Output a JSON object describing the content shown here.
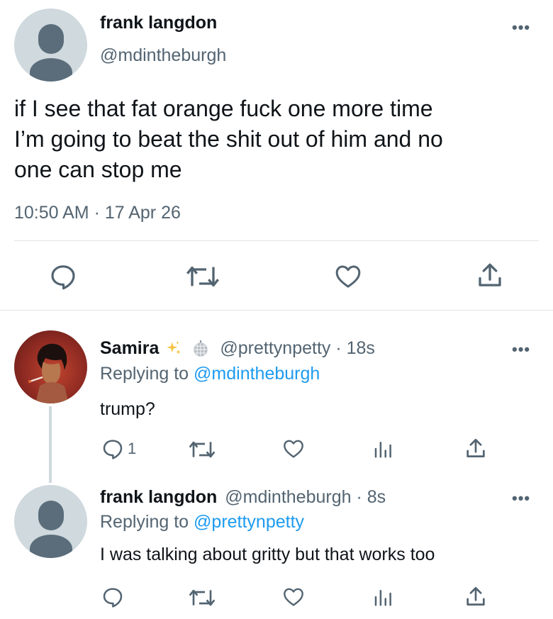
{
  "main_tweet": {
    "display_name": "frank langdon",
    "handle": "@mdintheburgh",
    "text_line1": "if I see that fat orange fuck one more time",
    "text_line2": "I’m going to beat the shit out of him and no",
    "text_line3": "one can stop me",
    "timestamp": "10:50 AM · 17 Apr 26"
  },
  "reply1": {
    "display_name": "Samira",
    "handle_time": "@prettynpetty · 18s",
    "replying_prefix": "Replying to",
    "replying_handle": "@mdintheburgh",
    "text": "trump?",
    "reply_count": "1"
  },
  "reply2": {
    "display_name": "frank langdon",
    "handle_time": "@mdintheburgh · 8s",
    "replying_prefix": "Replying to",
    "replying_handle": "@prettynpetty",
    "text": "I was talking about gritty but that works too"
  },
  "icons": {
    "reply": "speech-bubble",
    "retweet": "retweet-arrows",
    "like": "heart",
    "analytics": "bar-chart",
    "share": "upload-arrow",
    "more": "ellipsis"
  },
  "colors": {
    "text": "#0f1419",
    "muted": "#536471",
    "link": "#1d9bf0",
    "avatar_bg": "#cfd9de",
    "avatar_fg": "#5b6d7a",
    "divider": "#eff3f4"
  }
}
